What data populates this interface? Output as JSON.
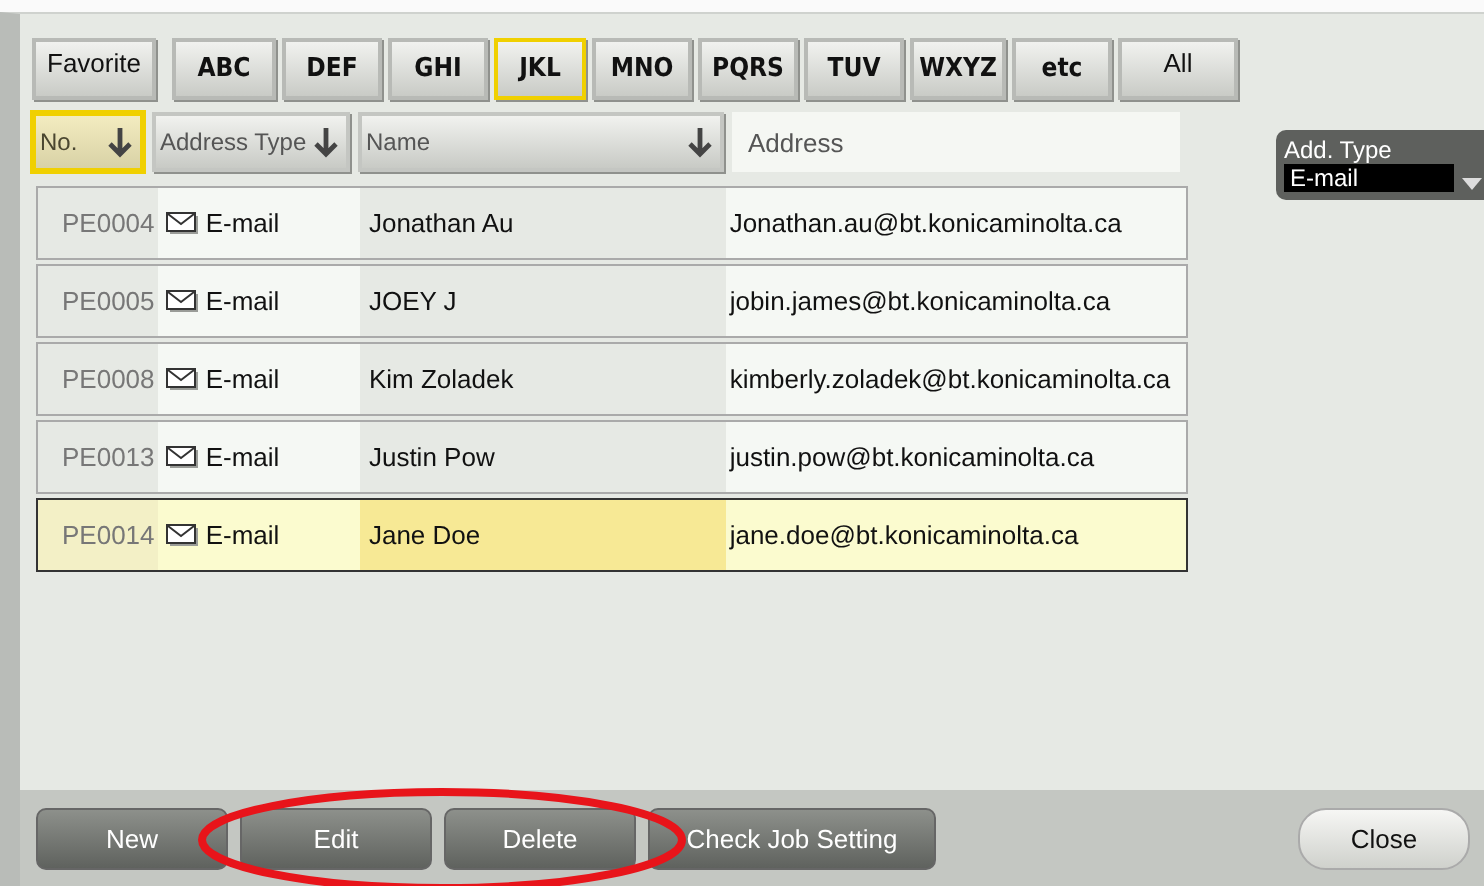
{
  "tabs": [
    {
      "label": "Favorite",
      "kind": "plain",
      "selected": false
    },
    {
      "label": "ABC",
      "kind": "letter",
      "selected": false
    },
    {
      "label": "DEF",
      "kind": "letter",
      "selected": false
    },
    {
      "label": "GHI",
      "kind": "letter",
      "selected": false
    },
    {
      "label": "JKL",
      "kind": "letter",
      "selected": true
    },
    {
      "label": "MNO",
      "kind": "letter",
      "selected": false
    },
    {
      "label": "PQRS",
      "kind": "letter",
      "selected": false
    },
    {
      "label": "TUV",
      "kind": "letter",
      "selected": false
    },
    {
      "label": "WXYZ",
      "kind": "letter",
      "selected": false
    },
    {
      "label": "etc",
      "kind": "letter",
      "selected": false
    },
    {
      "label": "All",
      "kind": "plain",
      "selected": false
    }
  ],
  "columns": [
    {
      "label": "No.",
      "kind": "sort",
      "selected": true
    },
    {
      "label": "Address Type",
      "kind": "sort",
      "selected": false
    },
    {
      "label": "Name",
      "kind": "sort",
      "selected": false
    },
    {
      "label": "Address",
      "kind": "plain"
    }
  ],
  "rows": [
    {
      "no": "PE0004",
      "type": "E-mail",
      "name": "Jonathan Au",
      "address": "Jonathan.au@bt.konicaminolta.ca",
      "selected": false
    },
    {
      "no": "PE0005",
      "type": "E-mail",
      "name": "JOEY J",
      "address": "jobin.james@bt.konicaminolta.ca",
      "selected": false
    },
    {
      "no": "PE0008",
      "type": "E-mail",
      "name": "Kim Zoladek",
      "address": "kimberly.zoladek@bt.konicaminolta.ca",
      "selected": false
    },
    {
      "no": "PE0013",
      "type": "E-mail",
      "name": "Justin Pow",
      "address": "justin.pow@bt.konicaminolta.ca",
      "selected": false
    },
    {
      "no": "PE0014",
      "type": "E-mail",
      "name": "Jane Doe",
      "address": "jane.doe@bt.konicaminolta.ca",
      "selected": true
    }
  ],
  "add_type": {
    "label": "Add. Type",
    "value": "E-mail"
  },
  "buttons": [
    {
      "label": "New",
      "kind": "dark"
    },
    {
      "label": "Edit",
      "kind": "dark"
    },
    {
      "label": "Delete",
      "kind": "dark"
    },
    {
      "label": "Check Job Setting",
      "kind": "dark"
    },
    {
      "label": "Close",
      "kind": "light"
    }
  ]
}
